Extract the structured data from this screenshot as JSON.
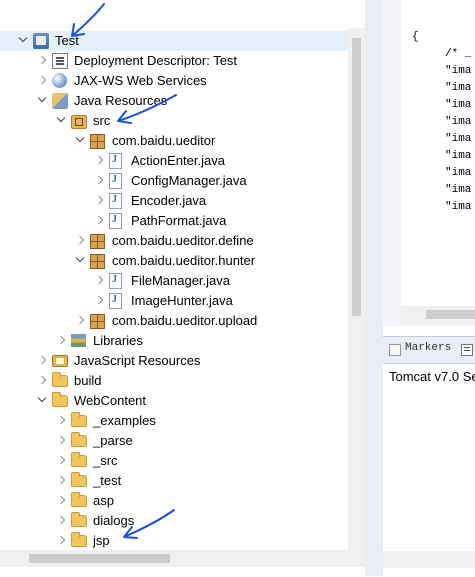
{
  "explorer": {
    "tree": [
      {
        "label": "Test",
        "icon": "project-icon",
        "state": "open",
        "level": 0,
        "selected": true
      },
      {
        "label": "Deployment Descriptor: Test",
        "icon": "deployment-descriptor-icon",
        "state": "closed",
        "level": 1
      },
      {
        "label": "JAX-WS Web Services",
        "icon": "jaxws-icon",
        "state": "closed",
        "level": 1
      },
      {
        "label": "Java Resources",
        "icon": "java-resources-icon",
        "state": "open",
        "level": 1
      },
      {
        "label": "src",
        "icon": "source-folder-icon",
        "state": "open",
        "level": 2
      },
      {
        "label": "com.baidu.ueditor",
        "icon": "package-icon",
        "state": "open",
        "level": 3
      },
      {
        "label": "ActionEnter.java",
        "icon": "java-file-icon",
        "state": "closed",
        "level": 4
      },
      {
        "label": "ConfigManager.java",
        "icon": "java-file-icon",
        "state": "closed",
        "level": 4
      },
      {
        "label": "Encoder.java",
        "icon": "java-file-icon",
        "state": "closed",
        "level": 4
      },
      {
        "label": "PathFormat.java",
        "icon": "java-file-icon",
        "state": "closed",
        "level": 4
      },
      {
        "label": "com.baidu.ueditor.define",
        "icon": "package-icon",
        "state": "closed",
        "level": 3
      },
      {
        "label": "com.baidu.ueditor.hunter",
        "icon": "package-icon",
        "state": "open",
        "level": 3
      },
      {
        "label": "FileManager.java",
        "icon": "java-file-icon",
        "state": "closed",
        "level": 4
      },
      {
        "label": "ImageHunter.java",
        "icon": "java-file-icon",
        "state": "closed",
        "level": 4
      },
      {
        "label": "com.baidu.ueditor.upload",
        "icon": "package-icon",
        "state": "closed",
        "level": 3
      },
      {
        "label": "Libraries",
        "icon": "libraries-icon",
        "state": "closed",
        "level": 2
      },
      {
        "label": "JavaScript Resources",
        "icon": "javascript-resources-icon",
        "state": "closed",
        "level": 1
      },
      {
        "label": "build",
        "icon": "folder-icon",
        "state": "closed",
        "level": 1
      },
      {
        "label": "WebContent",
        "icon": "folder-icon",
        "state": "open",
        "level": 1
      },
      {
        "label": "_examples",
        "icon": "folder-icon",
        "state": "closed",
        "level": 2
      },
      {
        "label": "_parse",
        "icon": "folder-icon",
        "state": "closed",
        "level": 2
      },
      {
        "label": "_src",
        "icon": "folder-icon",
        "state": "closed",
        "level": 2
      },
      {
        "label": "_test",
        "icon": "folder-icon",
        "state": "closed",
        "level": 2
      },
      {
        "label": "asp",
        "icon": "folder-icon",
        "state": "closed",
        "level": 2
      },
      {
        "label": "dialogs",
        "icon": "folder-icon",
        "state": "closed",
        "level": 2
      },
      {
        "label": "jsp",
        "icon": "folder-icon",
        "state": "closed",
        "level": 2
      }
    ]
  },
  "editor": {
    "lines": [
      "{",
      "/* _",
      "\"ima",
      "\"ima",
      "\"ima",
      "\"ima",
      "\"ima",
      "\"ima",
      "\"ima",
      "\"ima",
      "\"ima"
    ]
  },
  "panel": {
    "tab_markers": "Markers",
    "server_label": "Tomcat v7.0 Se"
  },
  "colors": {
    "annotation": "#1f4fe0",
    "selection": "#e6f0fa"
  }
}
